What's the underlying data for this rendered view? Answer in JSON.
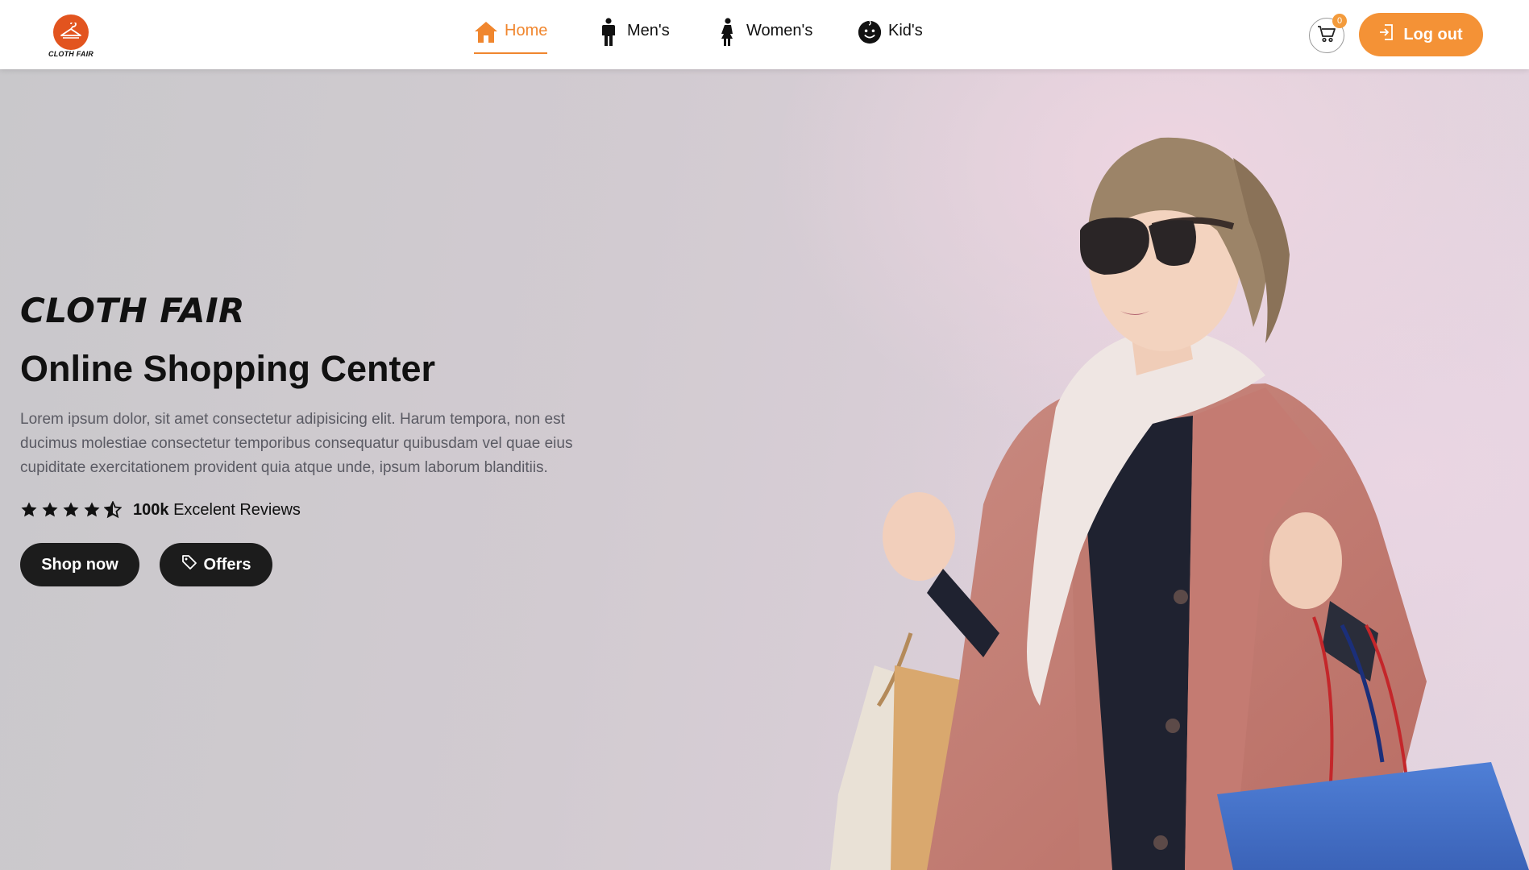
{
  "brand": {
    "logo_text": "CLOTH FAIR",
    "accent_color": "#f0862e",
    "logo_color": "#e2541f"
  },
  "nav": {
    "items": [
      {
        "label": "Home",
        "icon": "home-icon",
        "active": true
      },
      {
        "label": "Men's",
        "icon": "man-icon",
        "active": false
      },
      {
        "label": "Women's",
        "icon": "woman-icon",
        "active": false
      },
      {
        "label": "Kid's",
        "icon": "kid-face-icon",
        "active": false
      }
    ]
  },
  "cart": {
    "count": "0",
    "icon": "cart-icon"
  },
  "logout": {
    "label": "Log out",
    "icon": "logout-icon",
    "color": "#f49236"
  },
  "hero": {
    "brand_title": "CLOTH FAIR",
    "heading": "Online Shopping Center",
    "description": "Lorem ipsum dolor, sit amet consectetur adipisicing elit. Harum tempora, non est ducimus molestiae consectetur temporibus consequatur quibusdam vel quae eius cupiditate exercitationem provident quia atque unde, ipsum laborum blanditiis.",
    "rating": {
      "stars": 4.5,
      "max": 5,
      "count": "100k",
      "label": "Excelent Reviews"
    },
    "buttons": {
      "shop": "Shop now",
      "offers": "Offers",
      "offers_icon": "tag-icon"
    },
    "image": "woman-shopping-photo"
  }
}
